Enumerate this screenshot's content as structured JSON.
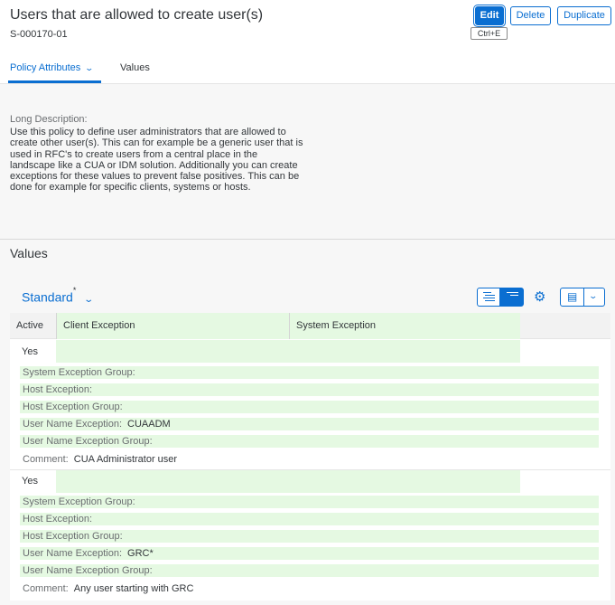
{
  "header": {
    "title": "Users that are allowed to create user(s)",
    "subtitle": "S-000170-01",
    "buttons": {
      "edit": "Edit",
      "delete": "Delete",
      "duplicate": "Duplicate"
    },
    "edit_tooltip": "Ctrl+E"
  },
  "tabs": [
    {
      "label": "Policy Attributes",
      "selected": true
    },
    {
      "label": "Values",
      "selected": false
    }
  ],
  "description": {
    "label": "Long Description:",
    "text": "Use this policy to define user administrators that are allowed to create other user(s). This can for example be a generic user that is used in RFC's to create users from a central place in the landscape like a CUA or IDM solution. Additionally you can create exceptions for these values to prevent false positives. This can be done for example for specific clients, systems or hosts."
  },
  "values_section": {
    "heading": "Values",
    "variant": "Standard",
    "variant_modified_marker": "*",
    "columns": [
      "Active",
      "Client Exception",
      "System Exception"
    ],
    "rows": [
      {
        "active": "Yes",
        "fields": [
          {
            "label": "System Exception Group:",
            "value": ""
          },
          {
            "label": "Host Exception:",
            "value": ""
          },
          {
            "label": "Host Exception Group:",
            "value": ""
          },
          {
            "label": "User Name Exception:",
            "value": "CUAADM"
          },
          {
            "label": "User Name Exception Group:",
            "value": ""
          }
        ],
        "comment_label": "Comment:",
        "comment": "CUA Administrator user"
      },
      {
        "active": "Yes",
        "fields": [
          {
            "label": "System Exception Group:",
            "value": ""
          },
          {
            "label": "Host Exception:",
            "value": ""
          },
          {
            "label": "Host Exception Group:",
            "value": ""
          },
          {
            "label": "User Name Exception:",
            "value": "GRC*"
          },
          {
            "label": "User Name Exception Group:",
            "value": ""
          }
        ],
        "comment_label": "Comment:",
        "comment": "Any user starting with GRC"
      }
    ]
  },
  "colors": {
    "accent": "#0a6ed1",
    "highlight_green": "#e5f9e2",
    "background": "#f7f7f7"
  },
  "icons": [
    "chevron-down-icon",
    "sort-list-icon",
    "gear-icon",
    "export-icon"
  ]
}
